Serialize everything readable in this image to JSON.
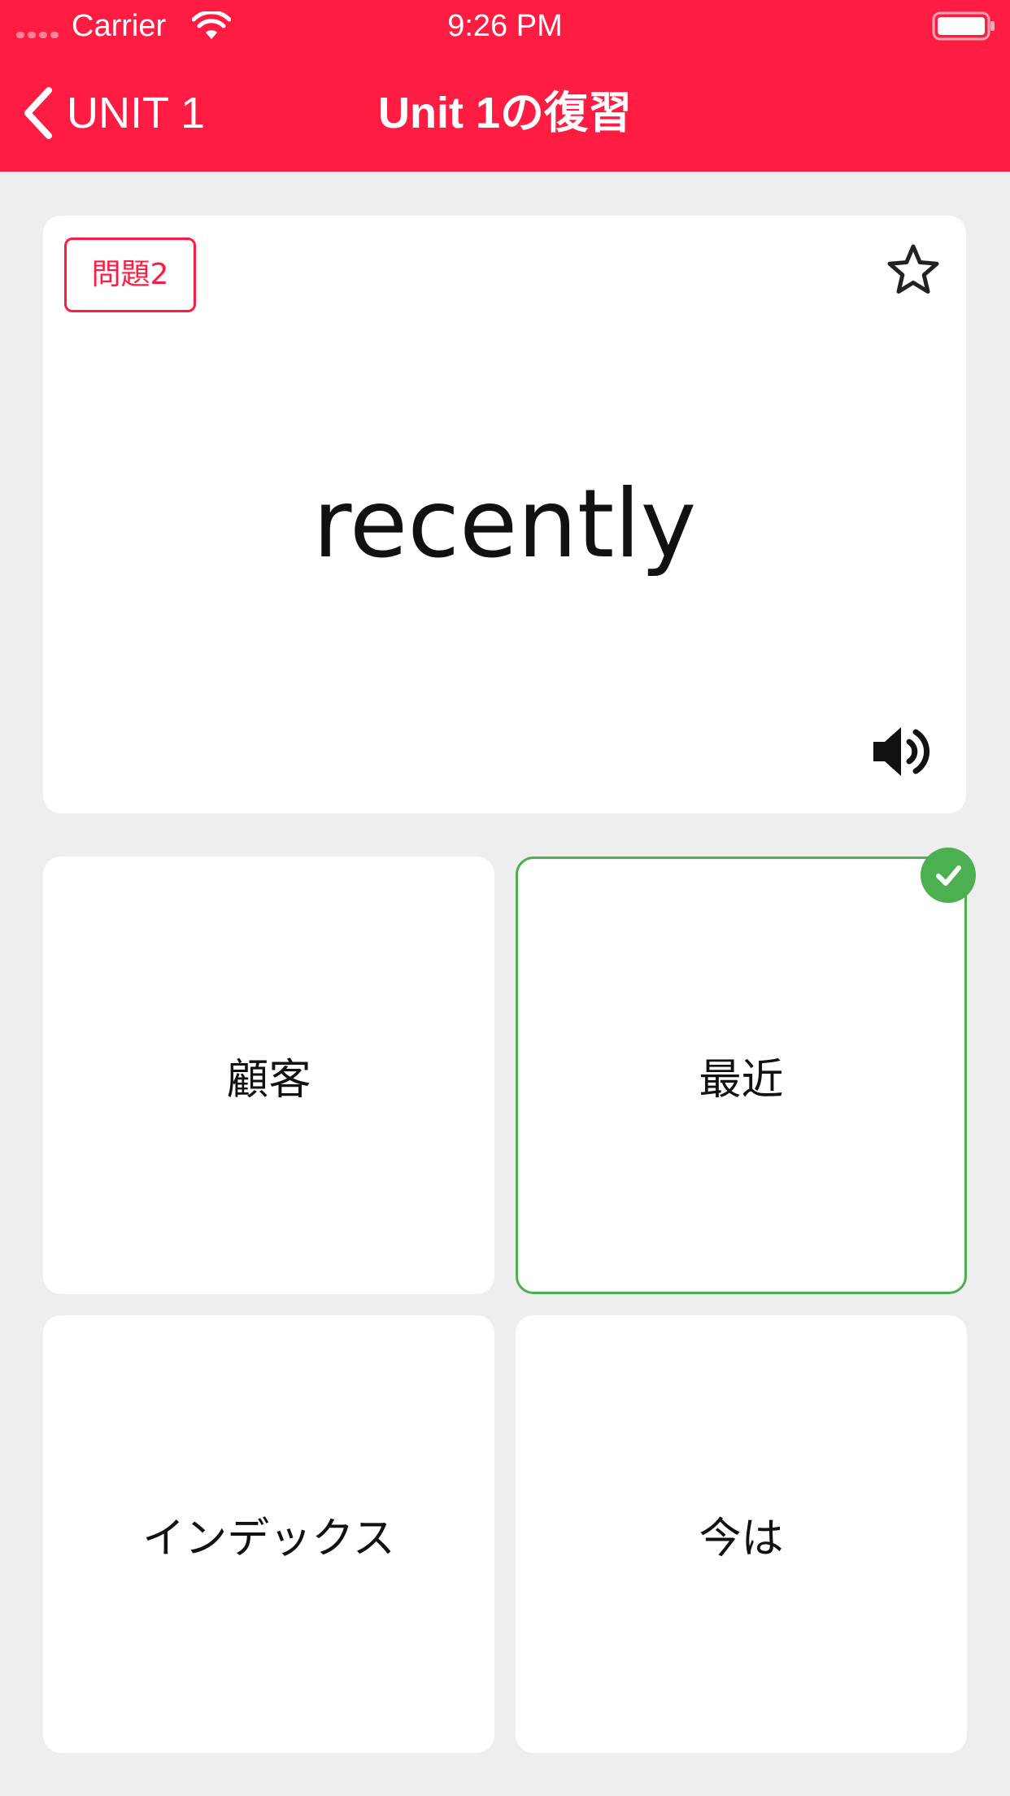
{
  "status_bar": {
    "carrier": "Carrier",
    "time": "9:26 PM"
  },
  "nav": {
    "back_label": "UNIT 1",
    "title": "Unit 1の復習"
  },
  "question": {
    "badge": "問題2",
    "word": "recently",
    "starred": false
  },
  "choices": [
    {
      "label": "顧客",
      "state": "default"
    },
    {
      "label": "最近",
      "state": "correct"
    },
    {
      "label": "インデックス",
      "state": "default"
    },
    {
      "label": "今は",
      "state": "default"
    }
  ],
  "colors": {
    "accent": "#ff1c43",
    "correct": "#4caf50",
    "background": "#eeeeee"
  },
  "icons": [
    "wifi-icon",
    "battery-icon",
    "chevron-left-icon",
    "star-outline-icon",
    "speaker-icon",
    "checkmark-icon"
  ]
}
